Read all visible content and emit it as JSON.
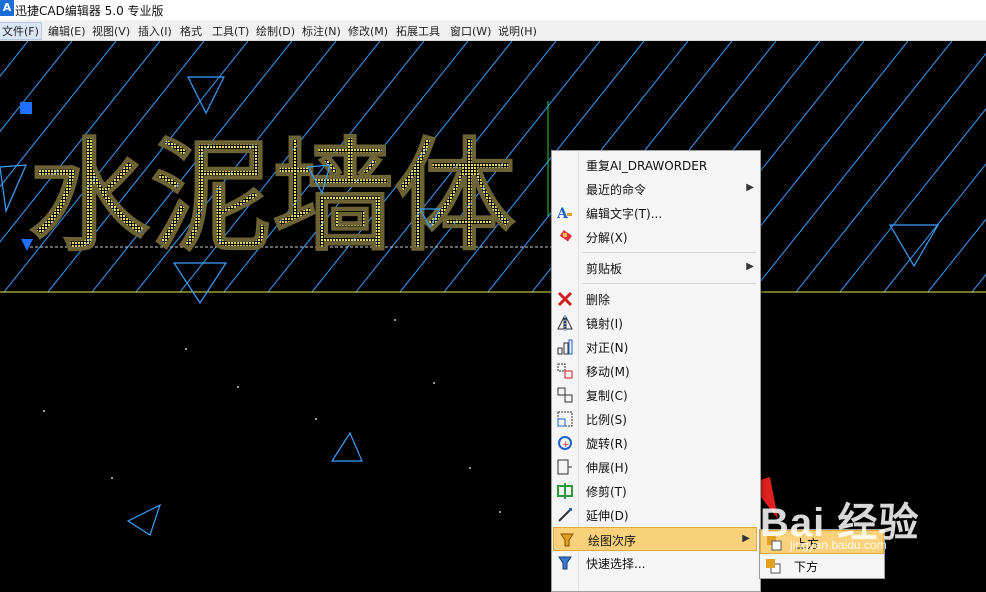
{
  "window": {
    "app_icon": "A",
    "title": "迅捷CAD编辑器 5.0 专业版"
  },
  "menubar": [
    {
      "label": "文件(F)",
      "active": true
    },
    {
      "label": "编辑(E)"
    },
    {
      "label": "视图(V)"
    },
    {
      "label": "插入(I)"
    },
    {
      "label": "格式"
    },
    {
      "label": "工具(T)"
    },
    {
      "label": "绘制(D)"
    },
    {
      "label": "标注(N)"
    },
    {
      "label": "修改(M)"
    },
    {
      "label": "拓展工具"
    },
    {
      "label": "窗口(W)"
    },
    {
      "label": "说明(H)"
    }
  ],
  "drawing": {
    "text_object": "水泥墙体",
    "hatch_color": "#3aa0ff",
    "text_color": "#e6d96a",
    "grip_color": "#1e6fff",
    "line_color": "#e8e84a",
    "background": "#000000"
  },
  "context_menu": {
    "items": [
      {
        "type": "item",
        "label": "重复AI_DRAWORDER",
        "icon": ""
      },
      {
        "type": "item",
        "label": "最近的命令",
        "submenu": true
      },
      {
        "type": "item",
        "label": "编辑文字(T)...",
        "icon": "edit-text-icon"
      },
      {
        "type": "item",
        "label": "分解(X)",
        "icon": "explode-icon"
      },
      {
        "type": "sep"
      },
      {
        "type": "item",
        "label": "剪贴板",
        "submenu": true
      },
      {
        "type": "sep"
      },
      {
        "type": "item",
        "label": "删除",
        "icon": "delete-icon"
      },
      {
        "type": "item",
        "label": "镜射(I)",
        "icon": "mirror-icon"
      },
      {
        "type": "item",
        "label": "对正(N)",
        "icon": "justify-icon"
      },
      {
        "type": "item",
        "label": "移动(M)",
        "icon": "move-icon"
      },
      {
        "type": "item",
        "label": "复制(C)",
        "icon": "copy-icon"
      },
      {
        "type": "item",
        "label": "比例(S)",
        "icon": "scale-icon"
      },
      {
        "type": "item",
        "label": "旋转(R)",
        "icon": "rotate-icon"
      },
      {
        "type": "item",
        "label": "伸展(H)",
        "icon": "stretch-icon"
      },
      {
        "type": "item",
        "label": "修剪(T)",
        "icon": "trim-icon"
      },
      {
        "type": "item",
        "label": "延伸(D)",
        "icon": "extend-icon"
      },
      {
        "type": "item",
        "label": "绘图次序",
        "submenu": true,
        "highlighted": true
      },
      {
        "type": "item",
        "label": "快速选择...",
        "icon": "quick-select-icon"
      }
    ]
  },
  "submenu": {
    "items": [
      {
        "label": "上方",
        "icon": "bring-front-icon",
        "highlighted": true
      },
      {
        "label": "下方",
        "icon": "send-back-icon"
      }
    ]
  },
  "watermark": {
    "text": "Bai 经验",
    "url": "jingyan.baidu.com"
  }
}
